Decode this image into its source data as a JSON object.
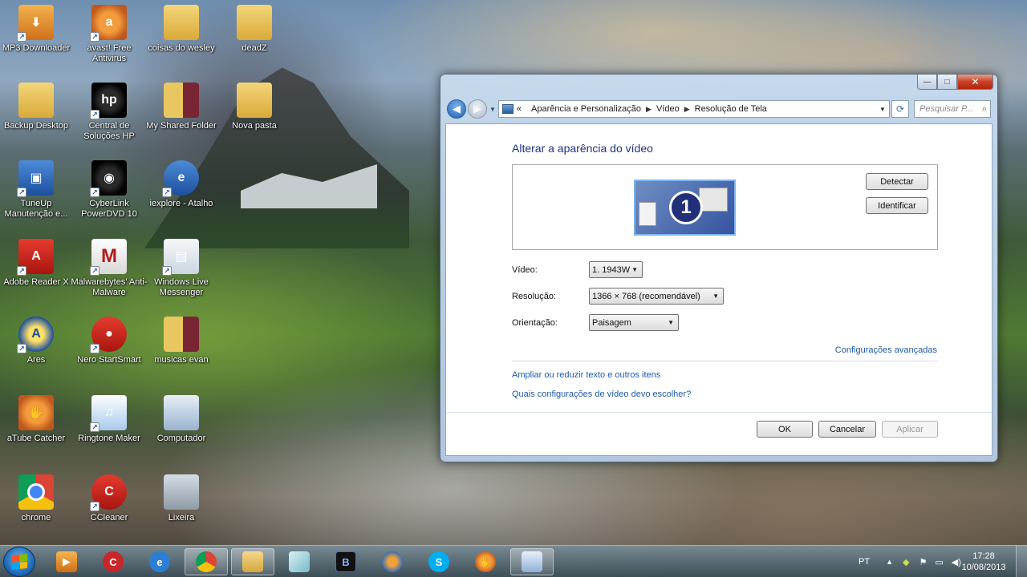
{
  "desktop": {
    "icons": [
      {
        "label": "MP3 Downloader",
        "icon": "mp3-downloader-icon"
      },
      {
        "label": "avast! Free Antivirus",
        "icon": "avast-icon"
      },
      {
        "label": "coisas do wesley",
        "icon": "folder-icon"
      },
      {
        "label": "deadZ",
        "icon": "folder-icon"
      },
      {
        "label": "Backup Desktop",
        "icon": "folder-icon"
      },
      {
        "label": "Central de Soluções HP",
        "icon": "hp-icon"
      },
      {
        "label": "My Shared Folder",
        "icon": "folder-icon"
      },
      {
        "label": "Nova pasta",
        "icon": "folder-icon"
      },
      {
        "label": "TuneUp Manutenção e...",
        "icon": "tuneup-icon"
      },
      {
        "label": "CyberLink PowerDVD 10",
        "icon": "powerdvd-icon"
      },
      {
        "label": "iexplore - Atalho",
        "icon": "internet-explorer-icon"
      },
      {
        "label": "Adobe Reader X",
        "icon": "adobe-reader-icon"
      },
      {
        "label": "Malwarebytes' Anti-Malware",
        "icon": "malwarebytes-icon"
      },
      {
        "label": "Windows Live Messenger",
        "icon": "windows-live-messenger-icon"
      },
      {
        "label": "Ares",
        "icon": "ares-icon"
      },
      {
        "label": "Nero StartSmart",
        "icon": "nero-icon"
      },
      {
        "label": "musicas evan",
        "icon": "folder-icon"
      },
      {
        "label": "aTube Catcher",
        "icon": "atube-catcher-icon"
      },
      {
        "label": "Ringtone Maker",
        "icon": "ringtone-maker-icon"
      },
      {
        "label": "Computador",
        "icon": "computer-icon"
      },
      {
        "label": "chrome",
        "icon": "chrome-icon"
      },
      {
        "label": "CCleaner",
        "icon": "ccleaner-icon"
      },
      {
        "label": "Lixeira",
        "icon": "recycle-bin-icon"
      }
    ]
  },
  "window": {
    "caption": {
      "minimize": "—",
      "maximize": "□",
      "close": "✕"
    },
    "breadcrumb": [
      "Aparência e Personalização",
      "Vídeo",
      "Resolução de Tela"
    ],
    "breadcrumb_prefix": "«",
    "search_placeholder": "Pesquisar P...",
    "heading": "Alterar a aparência do vídeo",
    "monitor_number": "1",
    "buttons": {
      "detect": "Detectar",
      "identify": "Identificar",
      "ok": "OK",
      "cancel": "Cancelar",
      "apply": "Aplicar"
    },
    "fields": {
      "video_label": "Vídeo:",
      "video_value": "1. 1943W",
      "resolution_label": "Resolução:",
      "resolution_value": "1366 × 768 (recomendável)",
      "orientation_label": "Orientação:",
      "orientation_value": "Paisagem"
    },
    "links": {
      "advanced": "Configurações avançadas",
      "text_size": "Ampliar ou reduzir texto e outros itens",
      "which_settings": "Quais configurações de vídeo devo escolher?"
    }
  },
  "taskbar": {
    "apps": [
      "media-player-icon",
      "ccleaner-icon",
      "internet-explorer-icon",
      "chrome-icon",
      "file-explorer-icon",
      "generic-app-icon",
      "bitdefender-icon",
      "media-center-icon",
      "skype-icon",
      "atube-catcher-icon",
      "display-settings-icon"
    ],
    "language": "PT",
    "time": "17:28",
    "date": "10/08/2013"
  }
}
